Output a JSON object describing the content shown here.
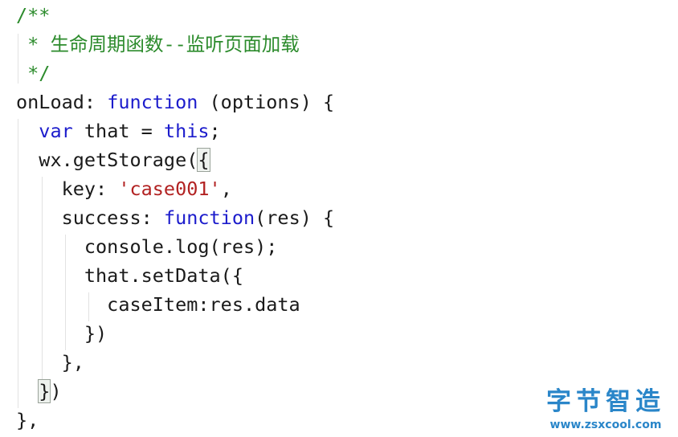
{
  "code": {
    "l1": "/**",
    "l2": " * 生命周期函数--监听页面加载",
    "l3": " */",
    "l4": {
      "a": "onLoad: ",
      "b": "function",
      "c": " (options) {"
    },
    "l5": {
      "a": "  ",
      "b": "var",
      "c": " that = ",
      "d": "this",
      "e": ";"
    },
    "l6": {
      "a": "  wx.getStorage(",
      "b": "{"
    },
    "l7": {
      "a": "    key: ",
      "b": "'case001'",
      "c": ","
    },
    "l8": {
      "a": "    success: ",
      "b": "function",
      "c": "(res) {"
    },
    "l9": "      console.log(res);",
    "l10": "      that.setData({",
    "l11": "        caseItem:res.data",
    "l12": "      })",
    "l13": "    },",
    "l14": {
      "a": "  ",
      "b": "}",
      "c": ")"
    },
    "l15": "},"
  },
  "watermark": {
    "title": "字节智造",
    "url": "www.zsxcool.com"
  },
  "colors": {
    "comment": "#2c8b2c",
    "keyword": "#1c1ccc",
    "string": "#b22222",
    "text": "#1a1a1a",
    "watermark": "#2a86c9"
  }
}
